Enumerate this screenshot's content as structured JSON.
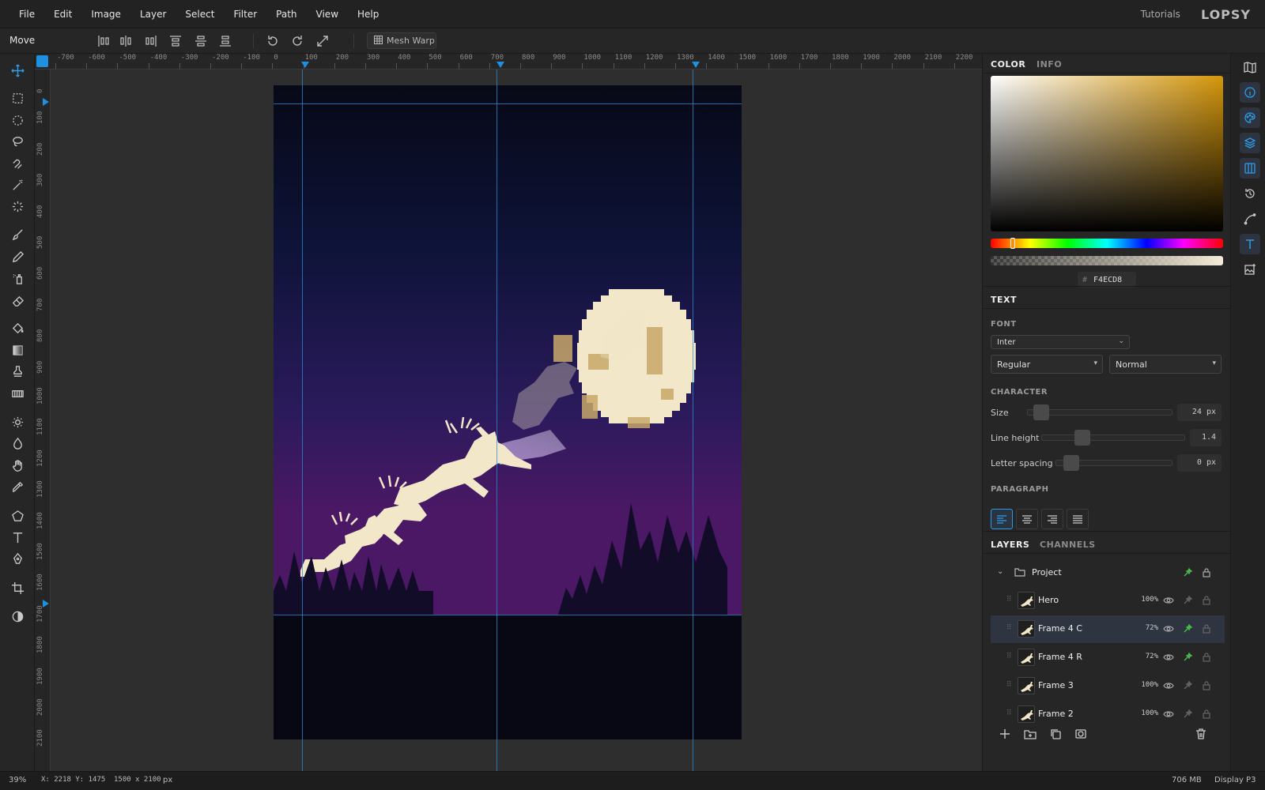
{
  "menubar": {
    "items": [
      "File",
      "Edit",
      "Image",
      "Layer",
      "Select",
      "Filter",
      "Path",
      "View",
      "Help"
    ],
    "tutorials": "Tutorials",
    "logo": "LOPSY"
  },
  "options": {
    "tool_name": "Move",
    "mesh_warp": "Mesh Warp"
  },
  "rulers": {
    "top": [
      "-700",
      "-600",
      "-500",
      "-400",
      "-300",
      "-200",
      "-100",
      "0",
      "100",
      "200",
      "300",
      "400",
      "500",
      "600",
      "700",
      "800",
      "900",
      "1000",
      "1100",
      "1200",
      "1300",
      "1400",
      "1500",
      "1600",
      "1700",
      "1800",
      "1900",
      "2000",
      "2100",
      "2200"
    ],
    "left": [
      "0",
      "100",
      "200",
      "300",
      "400",
      "500",
      "600",
      "700",
      "800",
      "900",
      "1000",
      "1100",
      "1200",
      "1300",
      "1400",
      "1500",
      "1600",
      "1700",
      "1800",
      "1900",
      "2000",
      "2100"
    ]
  },
  "panel": {
    "tabs": {
      "color": "COLOR",
      "info": "INFO",
      "text": "TEXT",
      "layers": "LAYERS",
      "channels": "CHANNELS"
    },
    "color": {
      "hex": "F4ECD8",
      "hash": "#",
      "accent": "#2f9be8"
    },
    "text": {
      "font_label": "FONT",
      "font": "Inter",
      "weight": "Regular",
      "style": "Normal",
      "character_label": "CHARACTER",
      "size_label": "Size",
      "size": "24 px",
      "line_height_label": "Line height",
      "line_height": "1.4",
      "letter_spacing_label": "Letter spacing",
      "letter_spacing": "0 px",
      "paragraph_label": "PARAGRAPH"
    },
    "layers": {
      "group": "Project",
      "items": [
        {
          "name": "Hero",
          "opacity": "100%"
        },
        {
          "name": "Frame 4 C",
          "opacity": "72%"
        },
        {
          "name": "Frame 4 R",
          "opacity": "72%"
        },
        {
          "name": "Frame 3",
          "opacity": "100%"
        },
        {
          "name": "Frame 2",
          "opacity": "100%"
        }
      ]
    }
  },
  "status": {
    "zoom": "39%",
    "coords": "X: 2218 Y: 1475",
    "size": "1500 x 2100",
    "unit": "px",
    "memory": "706 MB",
    "display": "Display P3"
  }
}
